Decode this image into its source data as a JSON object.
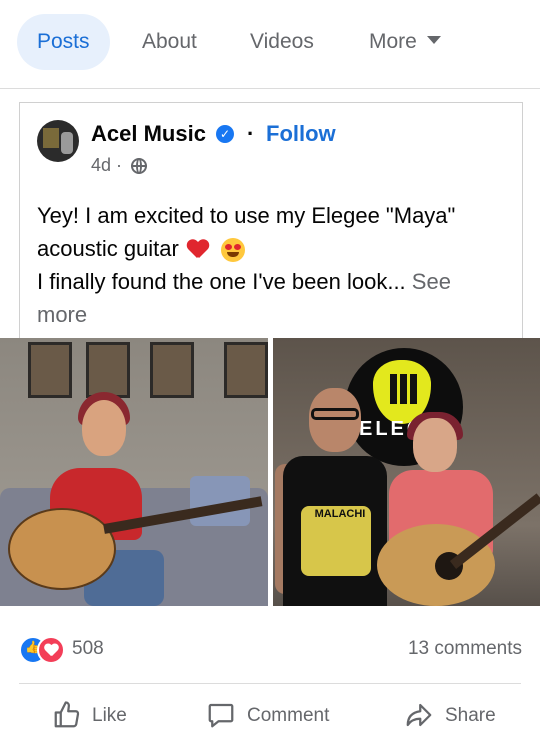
{
  "tabs": [
    {
      "label": "Posts",
      "active": true
    },
    {
      "label": "About"
    },
    {
      "label": "Videos"
    },
    {
      "label": "More"
    }
  ],
  "post": {
    "author": "Acel Music",
    "separator": "·",
    "follow_label": "Follow",
    "age": "4d ·",
    "text_line1": "Yey! I am excited to use my Elegee \"Maya\" acoustic guitar",
    "text_line2": "I finally found the one I've been look...",
    "see_more": "See more",
    "photo_sign_text": "ELEG",
    "photo_shirt_text": "MALACHI"
  },
  "reactions": {
    "count": "508",
    "comments": "13 comments"
  },
  "actions": {
    "like": "Like",
    "comment": "Comment",
    "share": "Share"
  },
  "colors": {
    "accent": "#1b6fd6",
    "verified": "#1877f2",
    "love": "#f33e58"
  },
  "icons": [
    "verified-badge-icon",
    "globe-icon",
    "chevron-down-icon",
    "like-reaction-icon",
    "love-reaction-icon",
    "thumbs-up-icon",
    "comment-icon",
    "share-icon"
  ]
}
